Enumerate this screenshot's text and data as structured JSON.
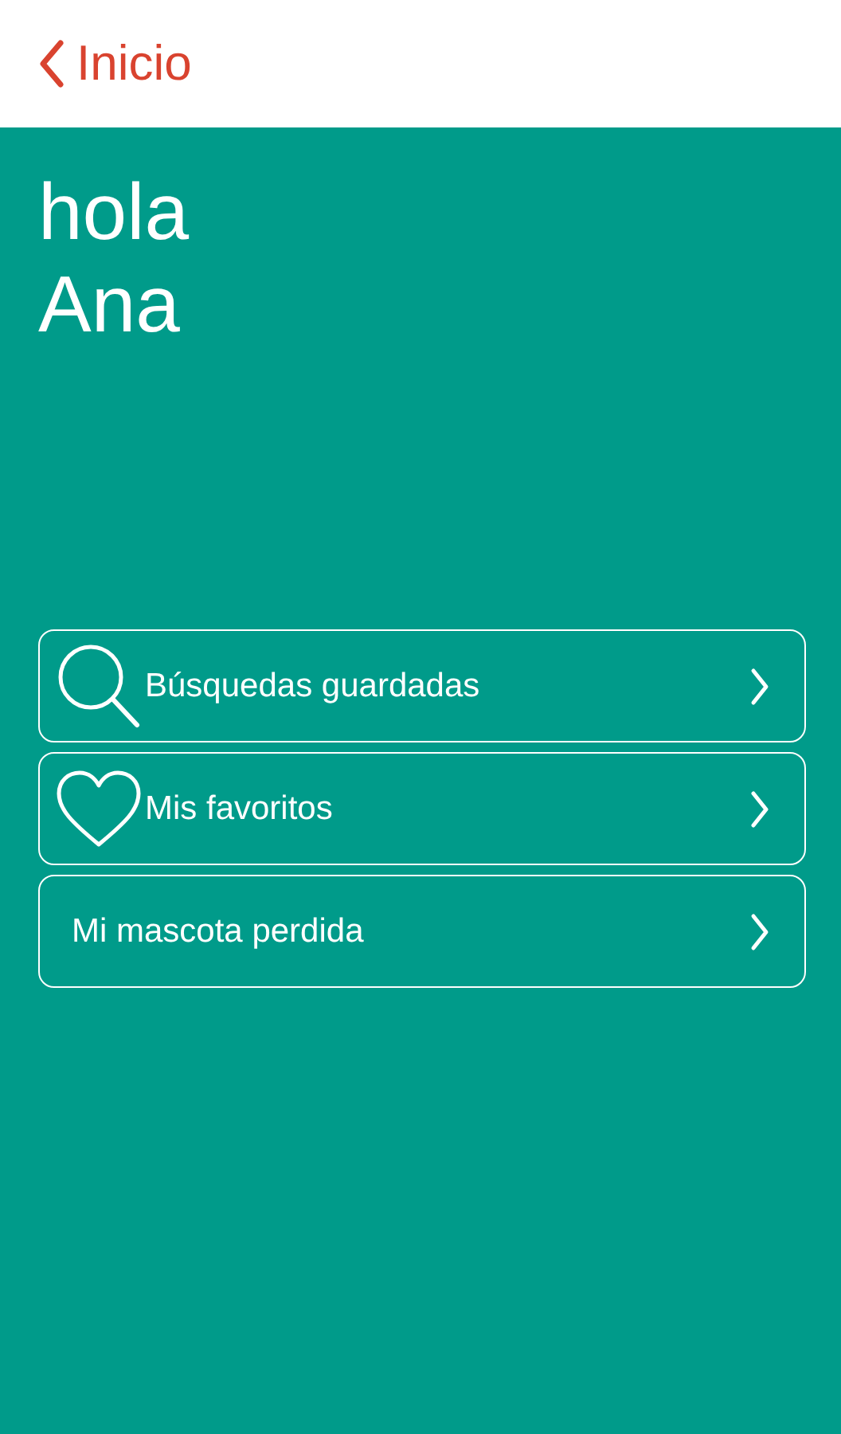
{
  "header": {
    "back_label": "Inicio"
  },
  "greeting": [
    "hola",
    "Ana"
  ],
  "menu": [
    {
      "kind": "search",
      "label": "Búsquedas guardadas"
    },
    {
      "kind": "heart",
      "label": "Mis favoritos"
    },
    {
      "kind": "plain",
      "label": "Mi mascota perdida"
    }
  ]
}
